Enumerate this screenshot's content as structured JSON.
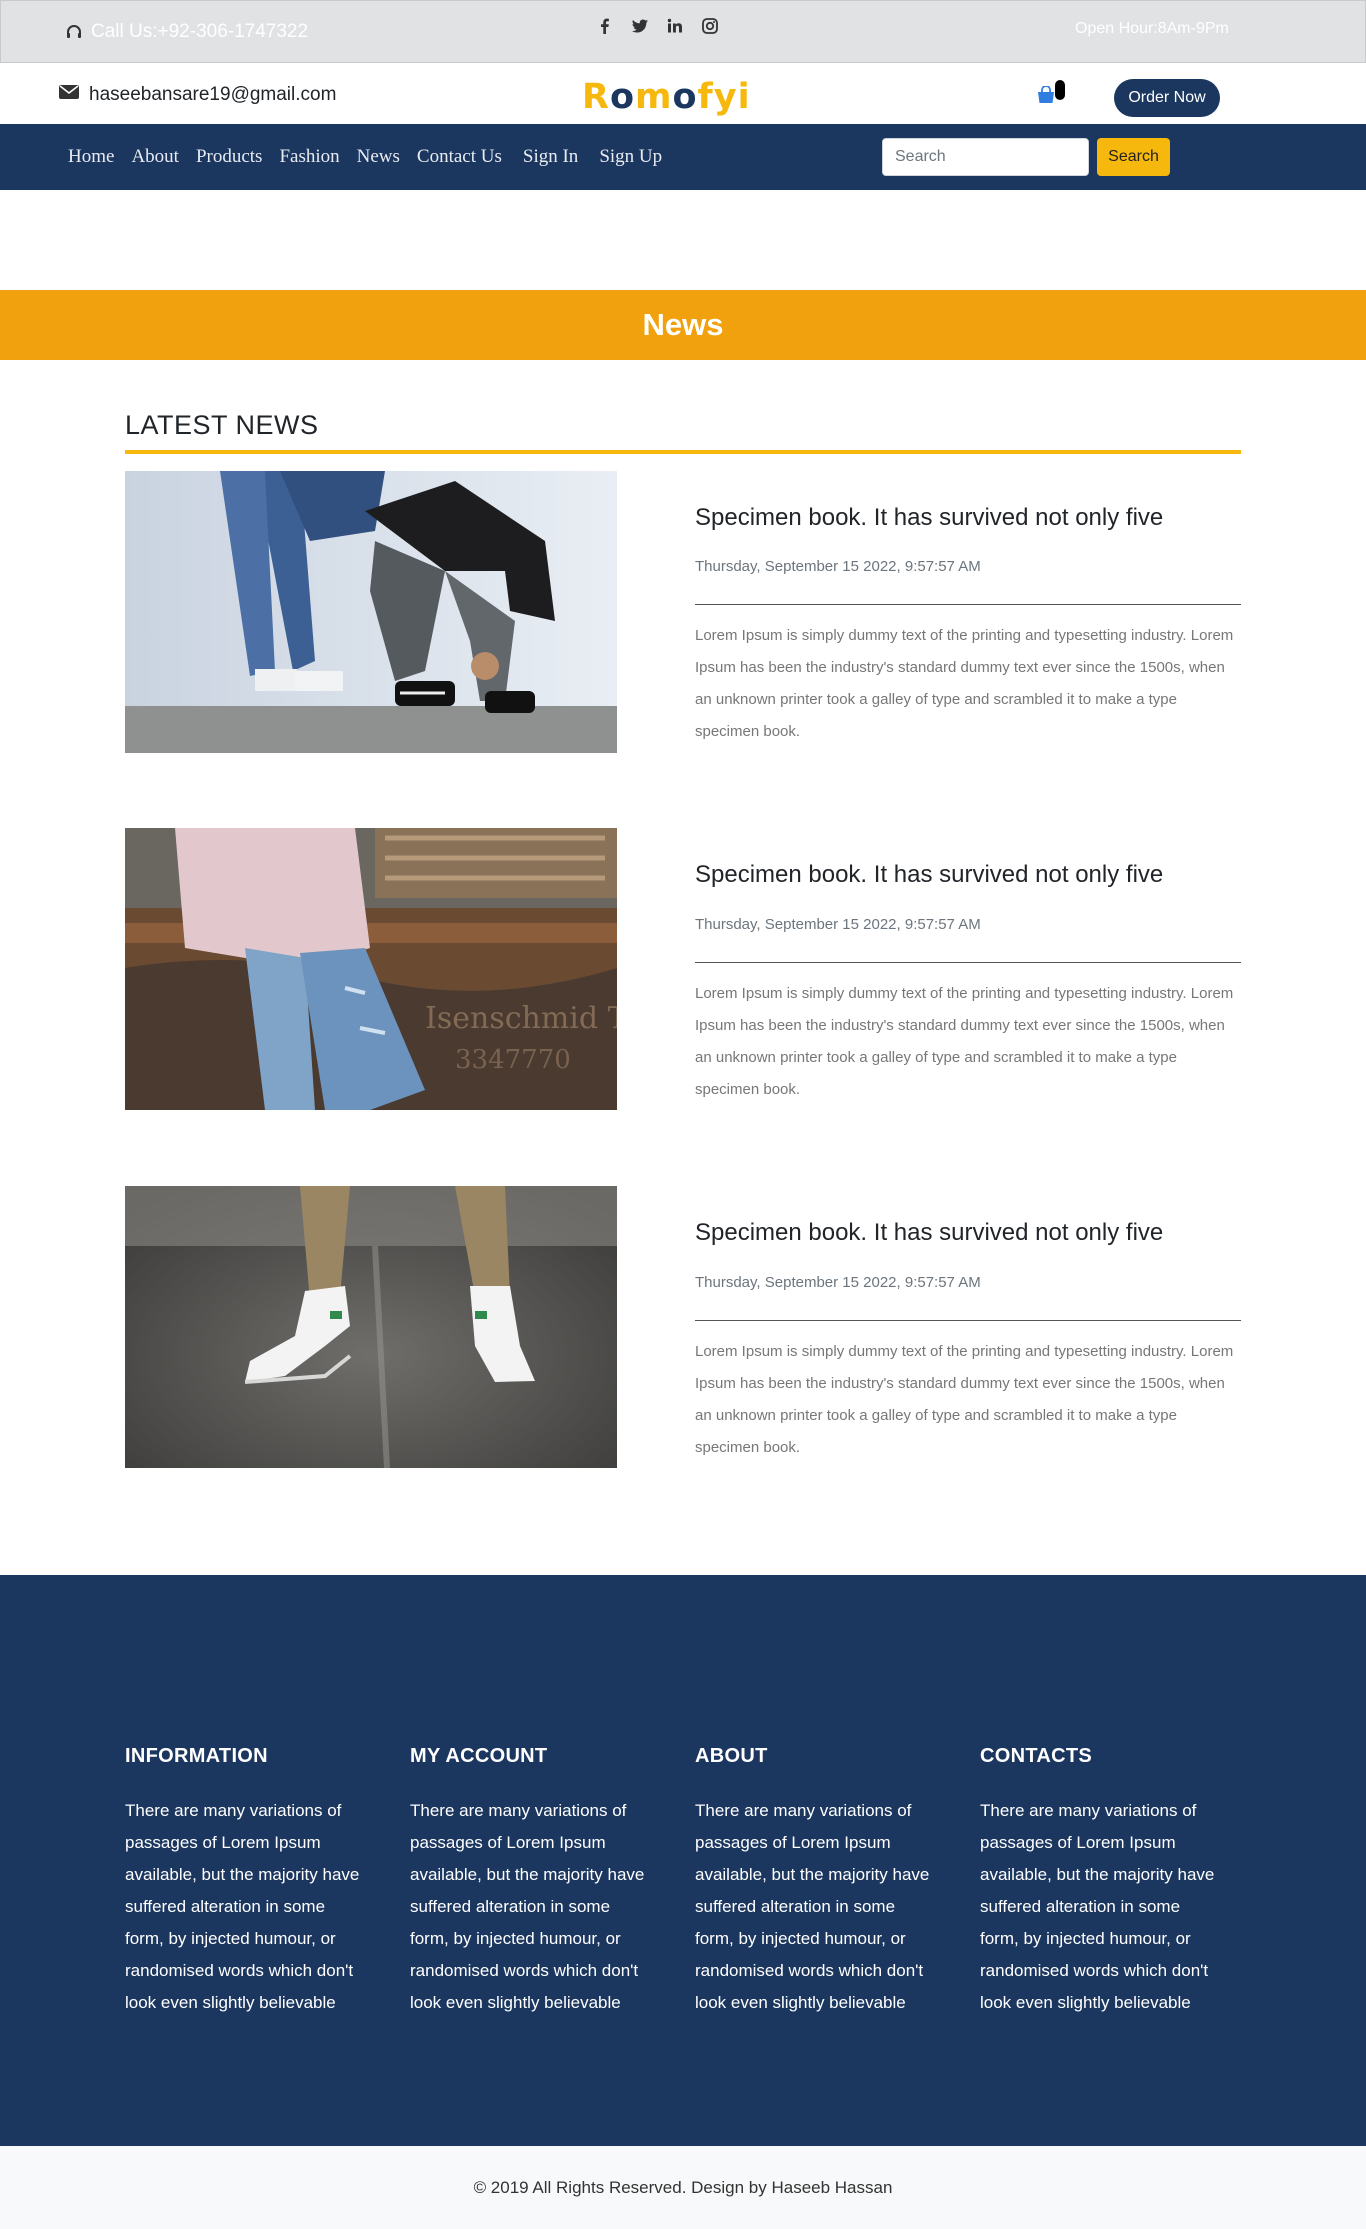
{
  "topbar": {
    "call": "Call Us:+92-306-1747322",
    "hours": "Open Hour:8Am-9Pm",
    "social": [
      "facebook-icon",
      "twitter-icon",
      "linkedin-icon",
      "instagram-icon"
    ]
  },
  "header": {
    "email": "haseebansare19@gmail.com",
    "logo": {
      "part1": "R",
      "part2": "o",
      "part3": "m",
      "part4": "o",
      "part5": "fyi"
    },
    "cart_count": "",
    "order_label": "Order Now"
  },
  "nav": {
    "items": [
      "Home",
      "About",
      "Products",
      "Fashion",
      "News",
      "Contact Us",
      "Sign In",
      "Sign Up"
    ],
    "search_placeholder": "Search",
    "search_label": "Search"
  },
  "banner": {
    "title": "News"
  },
  "latest": {
    "heading": "LATEST NEWS"
  },
  "news": [
    {
      "title": "Specimen book. It has survived not only five",
      "date": "Thursday, September 15 2022, 9:57:57 AM",
      "text": "Lorem Ipsum is simply dummy text of the printing and typesetting industry. Lorem Ipsum has been the industry's standard dummy text ever since the 1500s, when an unknown printer took a galley of type and scrambled it to make a type specimen book."
    },
    {
      "title": "Specimen book. It has survived not only five",
      "date": "Thursday, September 15 2022, 9:57:57 AM",
      "text": "Lorem Ipsum is simply dummy text of the printing and typesetting industry. Lorem Ipsum has been the industry's standard dummy text ever since the 1500s, when an unknown printer took a galley of type and scrambled it to make a type specimen book."
    },
    {
      "title": "Specimen book. It has survived not only five",
      "date": "Thursday, September 15 2022, 9:57:57 AM",
      "text": "Lorem Ipsum is simply dummy text of the printing and typesetting industry. Lorem Ipsum has been the industry's standard dummy text ever since the 1500s, when an unknown printer took a galley of type and scrambled it to make a type specimen book."
    }
  ],
  "footer": {
    "columns": [
      {
        "title": "INFORMATION",
        "text": "There are many variations of passages of Lorem Ipsum available, but the majority have suffered alteration in some form, by injected humour, or randomised words which don't look even slightly believable"
      },
      {
        "title": "MY ACCOUNT",
        "text": "There are many variations of passages of Lorem Ipsum available, but the majority have suffered alteration in some form, by injected humour, or randomised words which don't look even slightly believable"
      },
      {
        "title": "ABOUT",
        "text": "There are many variations of passages of Lorem Ipsum available, but the majority have suffered alteration in some form, by injected humour, or randomised words which don't look even slightly believable"
      },
      {
        "title": "CONTACTS",
        "text": "There are many variations of passages of Lorem Ipsum available, but the majority have suffered alteration in some form, by injected humour, or randomised words which don't look even slightly believable"
      }
    ],
    "copyright": "© 2019 All Rights Reserved. Design by Haseeb Hassan"
  },
  "colors": {
    "navy": "#1b365f",
    "orange_banner": "#f1a10d",
    "yellow_accent": "#f6b80c"
  }
}
